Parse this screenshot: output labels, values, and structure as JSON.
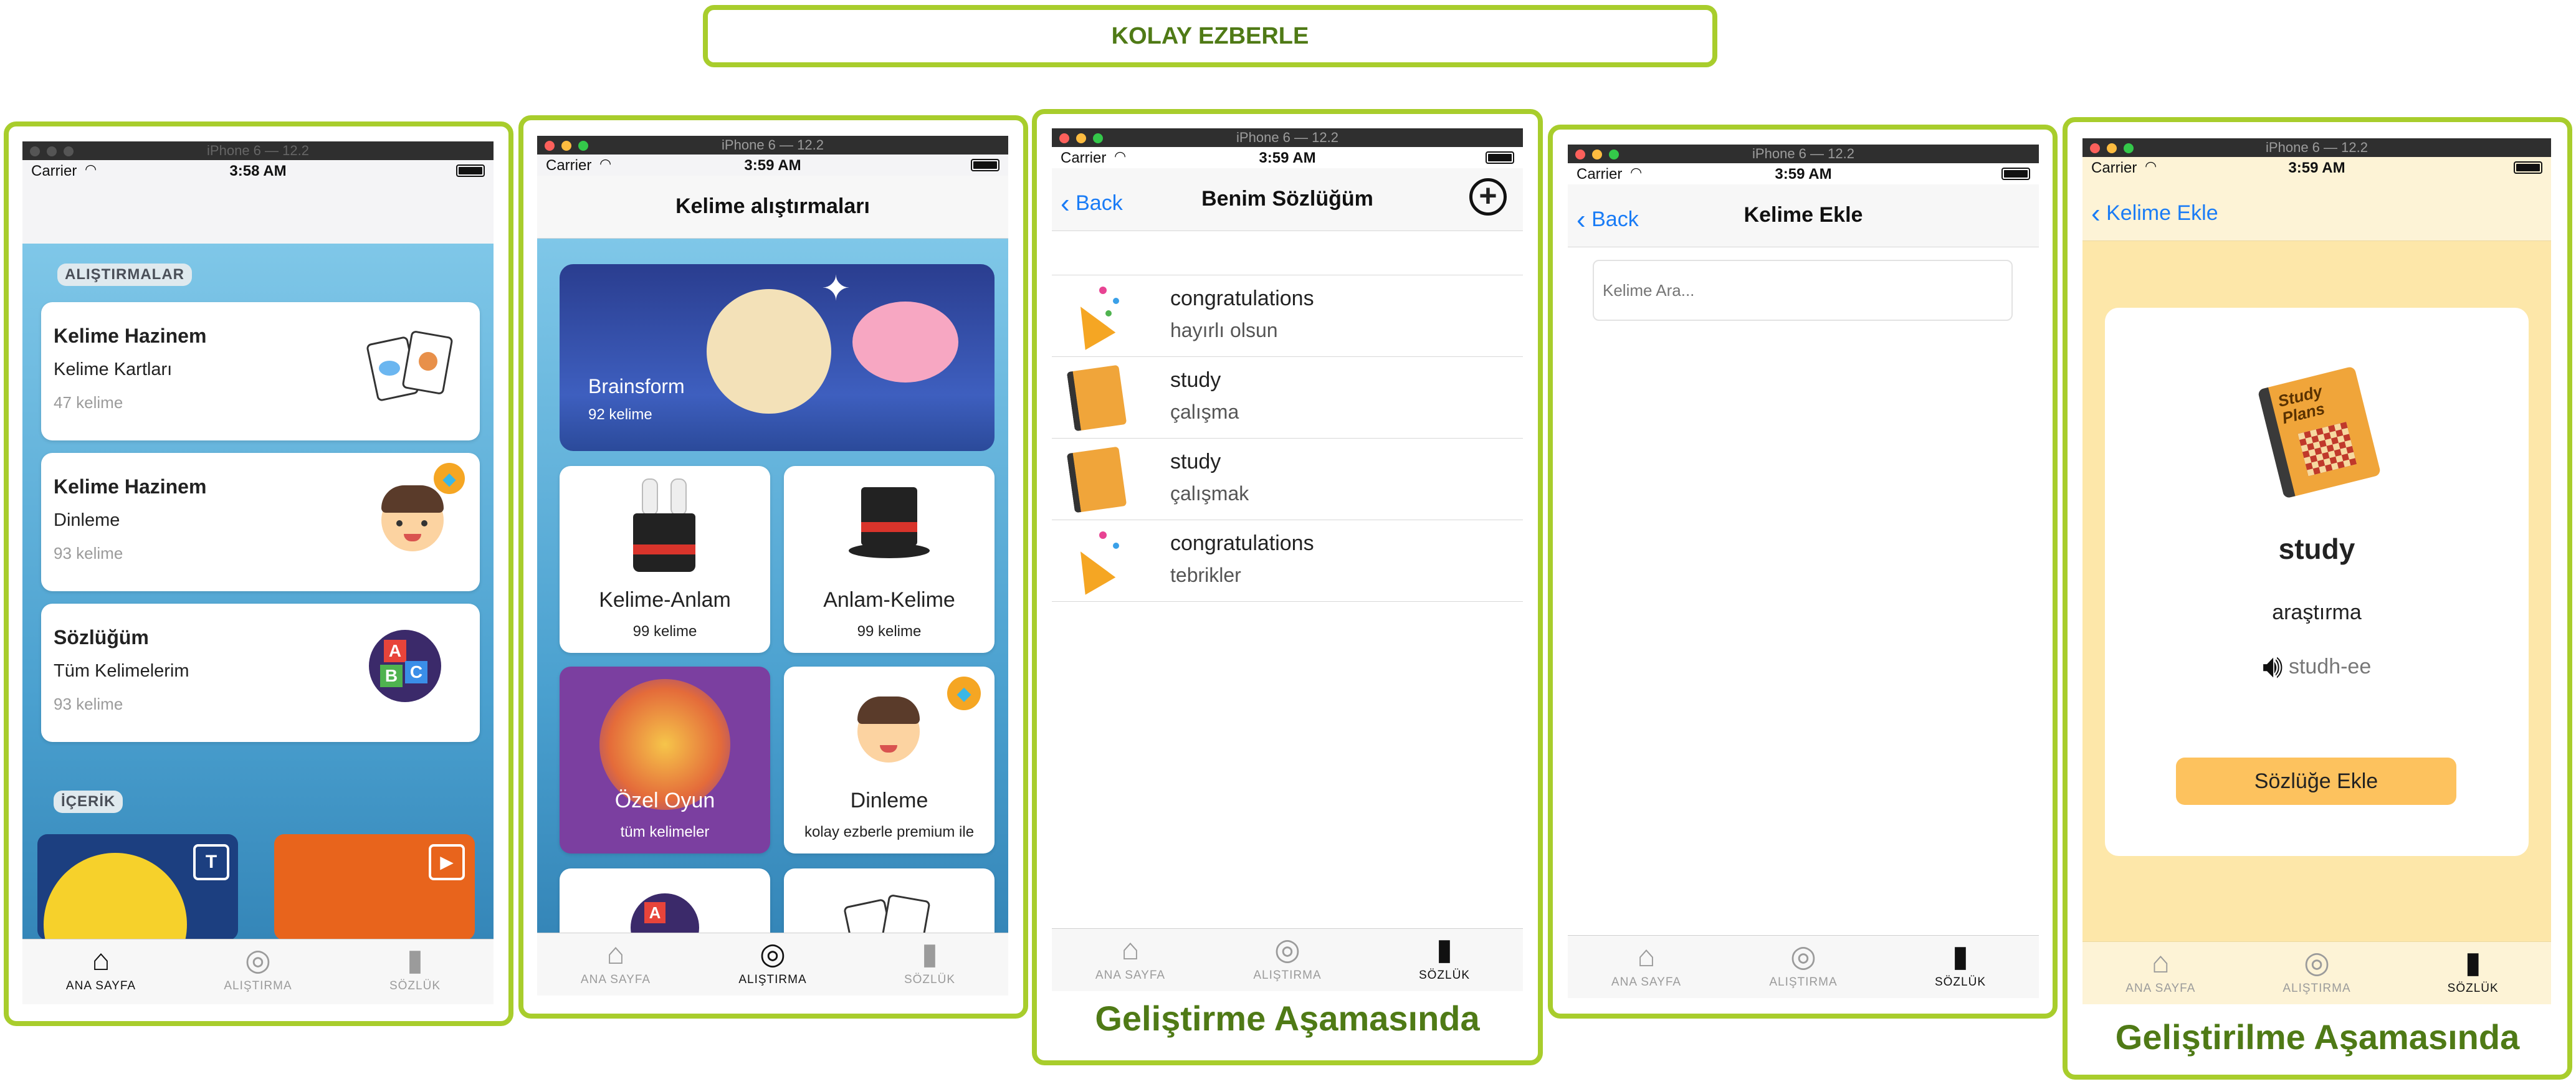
{
  "header_title": "KOLAY EZBERLE",
  "captions": {
    "dev1": "Geliştirme Aşamasında",
    "dev2": "Geliştirilme Aşamasında"
  },
  "window_title": "iPhone 6 — 12.2",
  "carrier": "Carrier",
  "tabs": {
    "home": "ANA SAYFA",
    "practice": "ALIŞTIRMA",
    "dict": "SÖZLÜK"
  },
  "screen1": {
    "time": "3:58 AM",
    "section1": "ALIŞTIRMALAR",
    "cards": [
      {
        "title": "Kelime Hazinem",
        "subtitle": "Kelime Kartları",
        "count": "47 kelime"
      },
      {
        "title": "Kelime Hazinem",
        "subtitle": "Dinleme",
        "count": "93 kelime"
      },
      {
        "title": "Sözlüğüm",
        "subtitle": "Tüm Kelimelerim",
        "count": "93 kelime"
      }
    ],
    "section2": "İÇERİK"
  },
  "screen2": {
    "time": "3:59 AM",
    "title": "Kelime alıştırmaları",
    "banner": {
      "title": "Brainsform",
      "count": "92 kelime"
    },
    "tiles": [
      {
        "title": "Kelime-Anlam",
        "sub": "99 kelime"
      },
      {
        "title": "Anlam-Kelime",
        "sub": "99 kelime"
      },
      {
        "title": "Özel Oyun",
        "sub": "tüm kelimeler"
      },
      {
        "title": "Dinleme",
        "sub": "kolay ezberle premium ile"
      }
    ]
  },
  "screen3": {
    "time": "3:59 AM",
    "back": "Back",
    "title": "Benim Sözlüğüm",
    "rows": [
      {
        "word": "congratulations",
        "meaning": "hayırlı olsun",
        "icon": "party-popper-icon"
      },
      {
        "word": "study",
        "meaning": "çalışma",
        "icon": "study-book-icon"
      },
      {
        "word": "study",
        "meaning": "çalışmak",
        "icon": "study-book-icon"
      },
      {
        "word": "congratulations",
        "meaning": "tebrikler",
        "icon": "party-popper-icon"
      }
    ]
  },
  "screen4": {
    "time": "3:59 AM",
    "back": "Back",
    "title": "Kelime Ekle",
    "search_placeholder": "Kelime Ara..."
  },
  "screen5": {
    "time": "3:59 AM",
    "back": "Kelime Ekle",
    "book_label": "Study Plans",
    "word": "study",
    "meaning": "araştırma",
    "pronunciation": "studh-ee",
    "add_button": "Sözlüğe Ekle"
  },
  "colors": {
    "accent_green": "#a8cd2c",
    "caption_green": "#4f7a16",
    "ios_blue": "#1a7cf6",
    "button_orange": "#fdc25e"
  }
}
